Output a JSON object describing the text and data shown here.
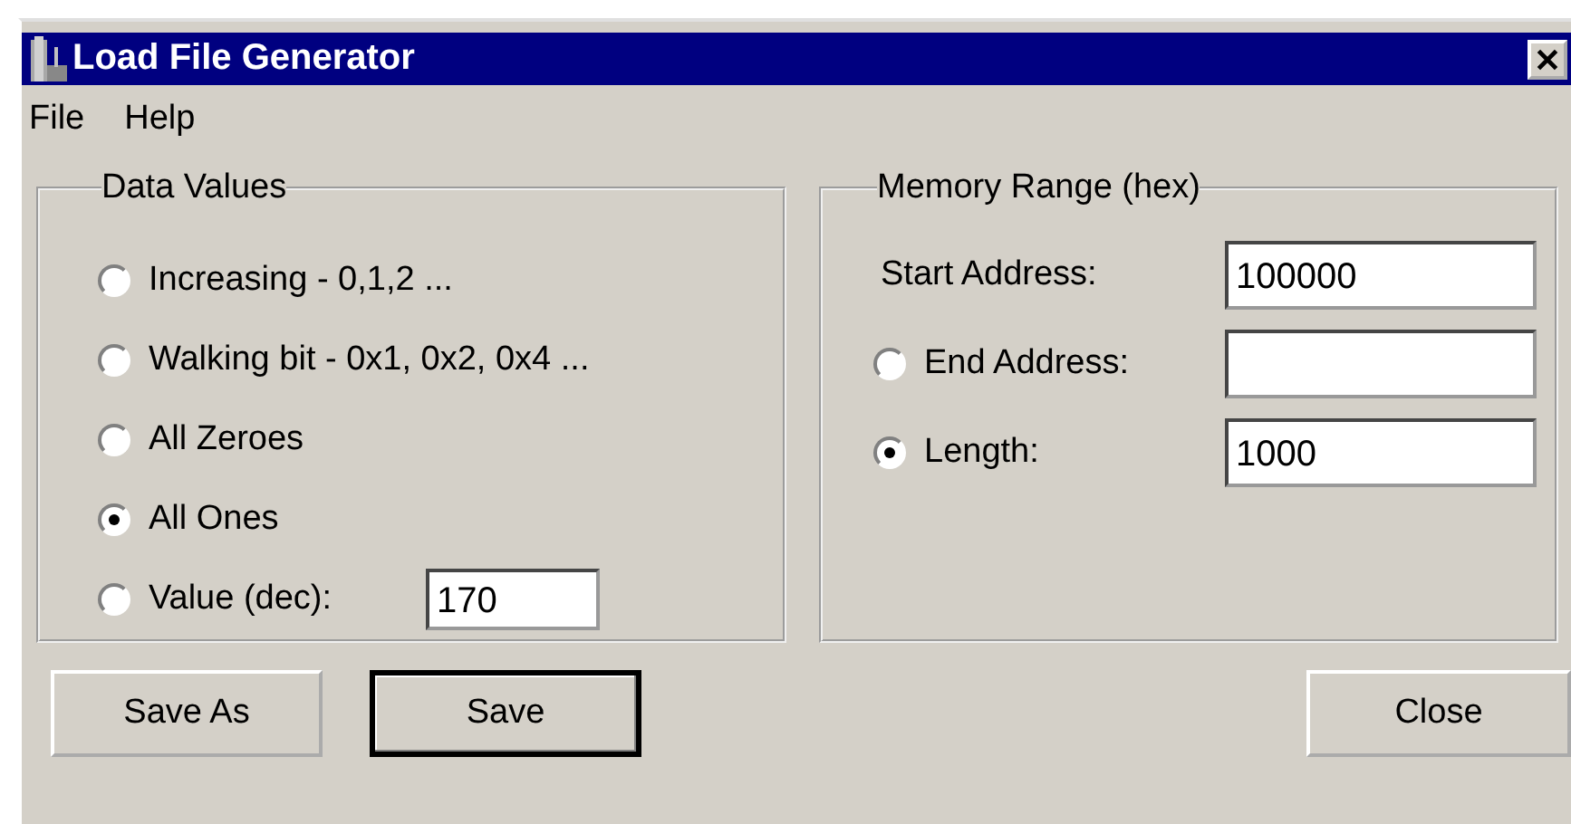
{
  "window": {
    "title": "Load File Generator"
  },
  "menu": [
    {
      "label": "File"
    },
    {
      "label": "Help"
    }
  ],
  "data_values": {
    "title": "Data Values",
    "options": [
      {
        "label": "Increasing - 0,1,2 ...",
        "selected": false
      },
      {
        "label": "Walking bit - 0x1, 0x2, 0x4 ...",
        "selected": false
      },
      {
        "label": "All Zeroes",
        "selected": false
      },
      {
        "label": "All Ones",
        "selected": true
      },
      {
        "label": "Value (dec):",
        "selected": false,
        "value": "170"
      }
    ]
  },
  "memory_range": {
    "title": "Memory Range (hex)",
    "rows": [
      {
        "kind": "label",
        "label": "Start Address:",
        "value": "100000"
      },
      {
        "kind": "radio",
        "label": "End Address:",
        "selected": false
      },
      {
        "kind": "radio",
        "label": "Length:",
        "selected": true,
        "value": "1000"
      }
    ]
  },
  "buttons": [
    {
      "label": "Save As",
      "default": false
    },
    {
      "label": "Save",
      "default": true
    },
    {
      "label": "Close",
      "default": false
    }
  ]
}
